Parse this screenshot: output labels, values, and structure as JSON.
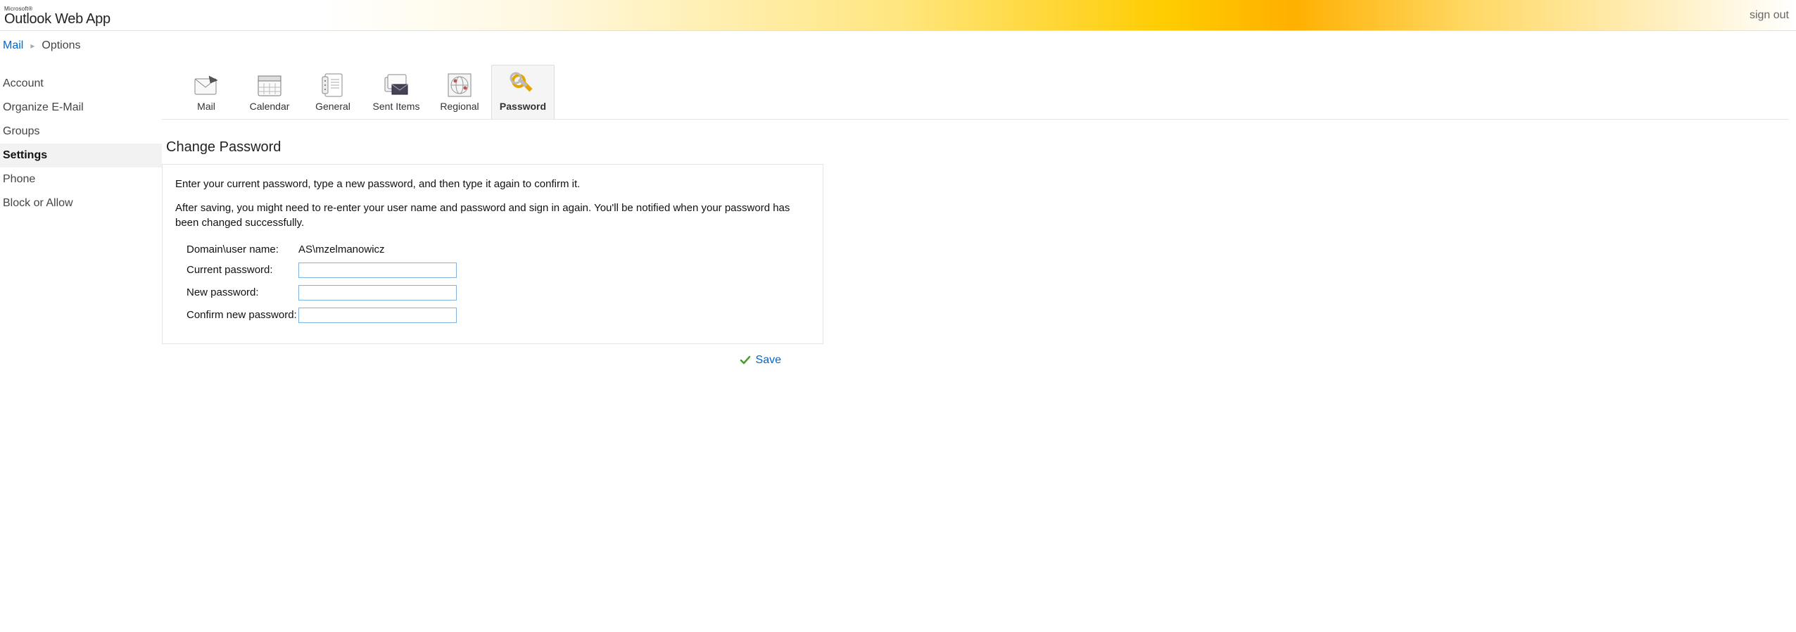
{
  "header": {
    "brand_prefix": "Microsoft®",
    "brand_main": "Outlook",
    "brand_suffix": "Web App",
    "signout": "sign out"
  },
  "breadcrumb": {
    "root": "Mail",
    "current": "Options"
  },
  "sidebar": {
    "items": [
      {
        "label": "Account",
        "active": false
      },
      {
        "label": "Organize E-Mail",
        "active": false
      },
      {
        "label": "Groups",
        "active": false
      },
      {
        "label": "Settings",
        "active": true
      },
      {
        "label": "Phone",
        "active": false
      },
      {
        "label": "Block or Allow",
        "active": false
      }
    ]
  },
  "tabs": {
    "items": [
      {
        "label": "Mail",
        "icon": "mail-icon"
      },
      {
        "label": "Calendar",
        "icon": "calendar-icon"
      },
      {
        "label": "General",
        "icon": "general-icon"
      },
      {
        "label": "Sent Items",
        "icon": "sentitems-icon"
      },
      {
        "label": "Regional",
        "icon": "regional-icon"
      },
      {
        "label": "Password",
        "icon": "password-icon"
      }
    ],
    "active_index": 5
  },
  "panel": {
    "title": "Change Password",
    "intro1": "Enter your current password, type a new password, and then type it again to confirm it.",
    "intro2": "After saving, you might need to re-enter your user name and password and sign in again. You'll be notified when your password has been changed successfully.",
    "form": {
      "domain_label": "Domain\\user name:",
      "domain_value": "AS\\mzelmanowicz",
      "current_label": "Current password:",
      "current_value": "",
      "new_label": "New password:",
      "new_value": "",
      "confirm_label": "Confirm new password:",
      "confirm_value": ""
    },
    "save_label": "Save"
  }
}
